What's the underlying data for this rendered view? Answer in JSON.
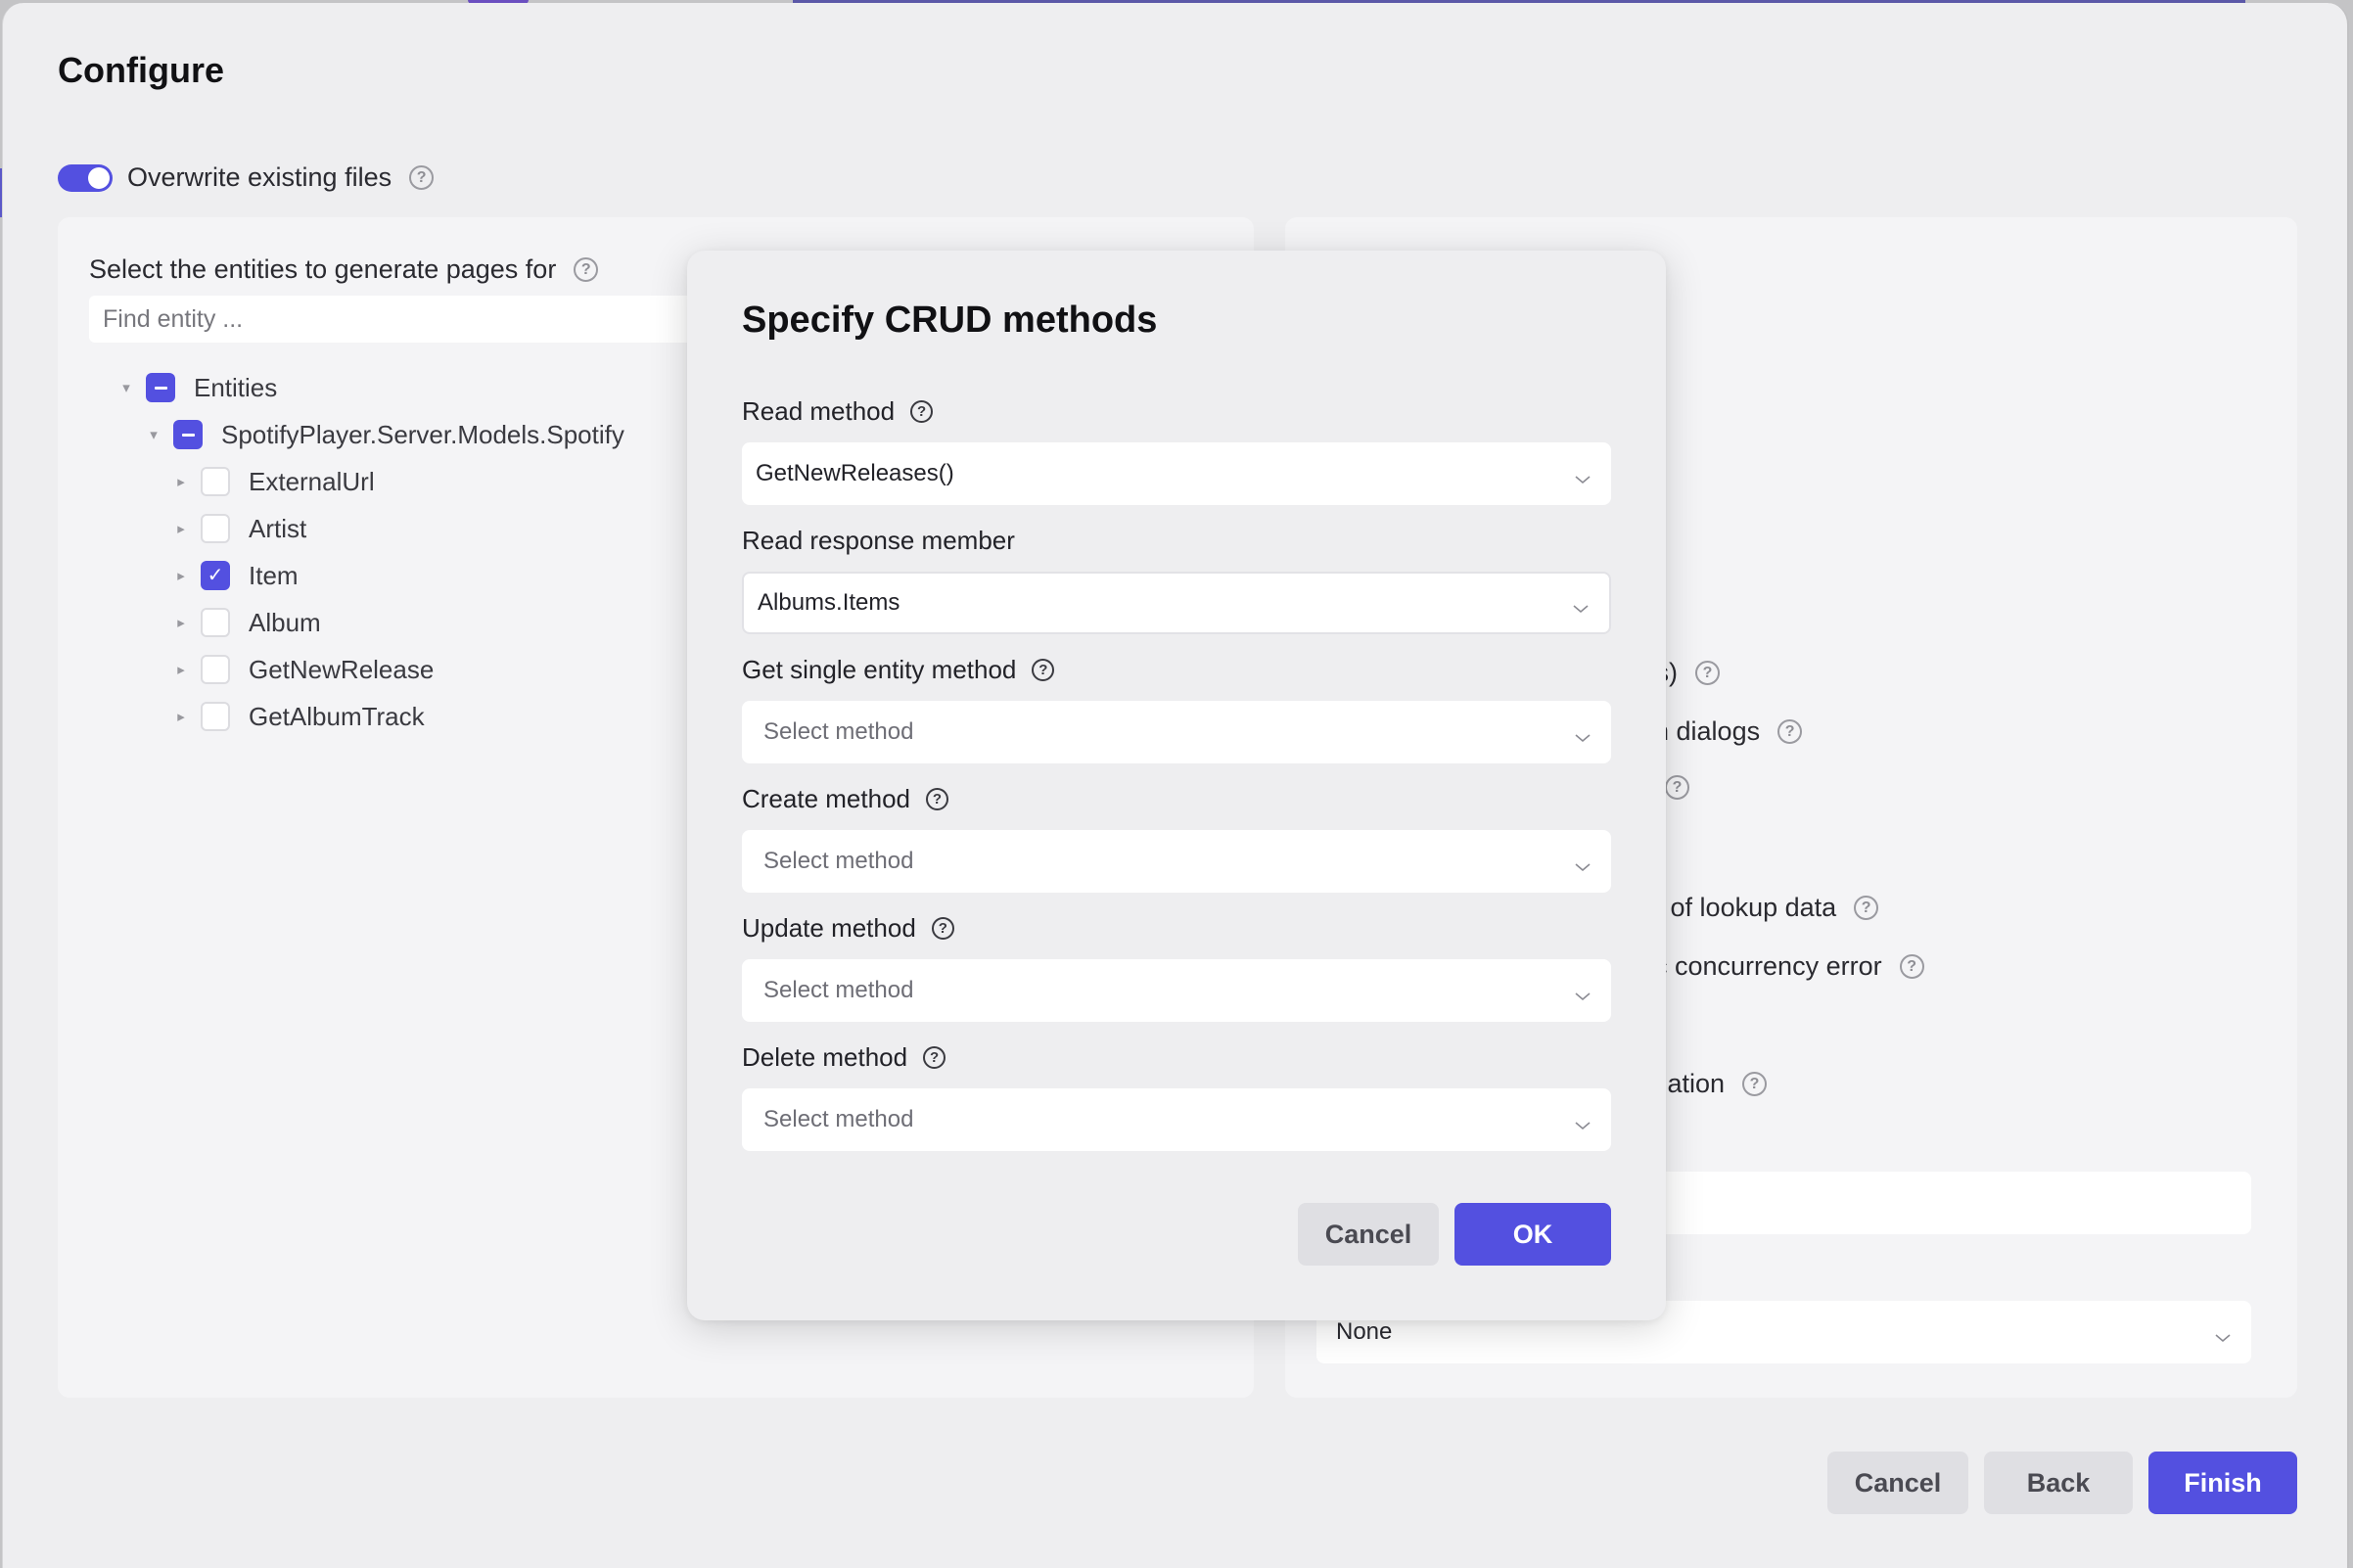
{
  "window": {
    "title": "Configure"
  },
  "overwrite": {
    "label": "Overwrite existing files",
    "enabled": true
  },
  "entities_panel": {
    "label": "Select the entities to generate pages for",
    "search_placeholder": "Find entity ...",
    "tree": {
      "root": {
        "label": "Entities",
        "state": "indeterminate",
        "expanded": true
      },
      "namespace": {
        "label": "SpotifyPlayer.Server.Models.Spotify",
        "state": "indeterminate",
        "expanded": true
      },
      "items": [
        {
          "label": "ExternalUrl",
          "checked": false
        },
        {
          "label": "Artist",
          "checked": false
        },
        {
          "label": "Item",
          "checked": true
        },
        {
          "label": "Album",
          "checked": false
        },
        {
          "label": "GetNewRelease",
          "checked": false
        },
        {
          "label": "GetAlbumTrack",
          "checked": false
        }
      ]
    }
  },
  "options_panel": {
    "partial_rows": [
      "r.cs)",
      "s in dialogs",
      "",
      "ing of lookup data",
      "stic concurrency error",
      "ivigation"
    ],
    "select_value": "None"
  },
  "modal": {
    "title": "Specify CRUD methods",
    "fields": [
      {
        "label": "Read method",
        "value": "GetNewReleases()",
        "placeholder": "Select method",
        "help": true
      },
      {
        "label": "Read response member",
        "value": "Albums.Items",
        "placeholder": "Select method",
        "help": false
      },
      {
        "label": "Get single entity method",
        "value": "",
        "placeholder": "Select method",
        "help": true
      },
      {
        "label": "Create method",
        "value": "",
        "placeholder": "Select method",
        "help": true
      },
      {
        "label": "Update method",
        "value": "",
        "placeholder": "Select method",
        "help": true
      },
      {
        "label": "Delete method",
        "value": "",
        "placeholder": "Select method",
        "help": true
      }
    ],
    "cancel_label": "Cancel",
    "ok_label": "OK"
  },
  "footer": {
    "cancel_label": "Cancel",
    "back_label": "Back",
    "finish_label": "Finish"
  },
  "icons": {
    "help": "?",
    "check": "✓",
    "caret_down": "▾",
    "caret_right": "▸"
  },
  "colors": {
    "accent": "#5350e0",
    "window_bg": "#eeeef0",
    "panel_bg": "#f4f4f6",
    "secondary_button": "#dfdfe3"
  }
}
